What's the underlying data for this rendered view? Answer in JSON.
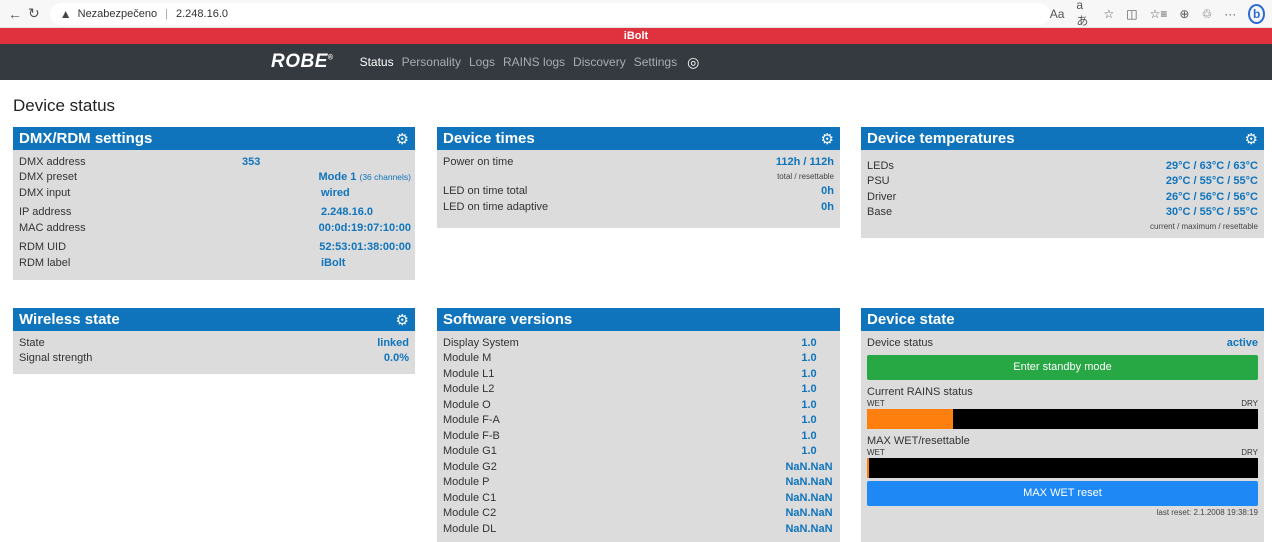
{
  "browser": {
    "back_icon": "←",
    "reload_icon": "↻",
    "security_text": "Nezabezpečeno",
    "url": "2.248.16.0",
    "icons": [
      "Aa",
      "aあ",
      "☆",
      "◫",
      "☆≡",
      "⊕",
      "♲",
      "···"
    ],
    "bing_label": "b"
  },
  "app": {
    "device_name": "iBolt",
    "logo": "ROBE",
    "nav": [
      "Status",
      "Personality",
      "Logs",
      "RAINS logs",
      "Discovery",
      "Settings"
    ],
    "active_nav": "Status"
  },
  "page_title": "Device status",
  "dmx": {
    "title": "DMX/RDM settings",
    "rows": [
      {
        "label": "DMX address",
        "value": "353"
      },
      {
        "label": "DMX preset",
        "value": "Mode 1",
        "extra": "(36 channels)"
      },
      {
        "label": "DMX input",
        "value": "wired"
      },
      {
        "label": "IP address",
        "value": "2.248.16.0"
      },
      {
        "label": "MAC address",
        "value": "00:0d:19:07:10:00"
      },
      {
        "label": "RDM UID",
        "value": "52:53:01:38:00:00"
      },
      {
        "label": "RDM label",
        "value": "iBolt"
      }
    ]
  },
  "times": {
    "title": "Device times",
    "power_on_label": "Power on time",
    "power_on_value": "112h / 112h",
    "power_on_note": "total / resettable",
    "led_total_label": "LED on time total",
    "led_total_value": "0h",
    "led_adaptive_label": "LED on time adaptive",
    "led_adaptive_value": "0h"
  },
  "temps": {
    "title": "Device temperatures",
    "rows": [
      {
        "label": "LEDs",
        "value": "29°C / 63°C / 63°C"
      },
      {
        "label": "PSU",
        "value": "29°C / 55°C / 55°C"
      },
      {
        "label": "Driver",
        "value": "26°C / 56°C / 56°C"
      },
      {
        "label": "Base",
        "value": "30°C / 55°C / 55°C"
      }
    ],
    "note": "current / maximum / resettable"
  },
  "wireless": {
    "title": "Wireless state",
    "rows": [
      {
        "label": "State",
        "value": "linked"
      },
      {
        "label": "Signal strength",
        "value": "0.0%"
      }
    ]
  },
  "software": {
    "title": "Software versions",
    "rows": [
      {
        "label": "Display System",
        "value": "1.0"
      },
      {
        "label": "Module M",
        "value": "1.0"
      },
      {
        "label": "Module L1",
        "value": "1.0"
      },
      {
        "label": "Module L2",
        "value": "1.0"
      },
      {
        "label": "Module O",
        "value": "1.0"
      },
      {
        "label": "Module F-A",
        "value": "1.0"
      },
      {
        "label": "Module F-B",
        "value": "1.0"
      },
      {
        "label": "Module G1",
        "value": "1.0"
      },
      {
        "label": "Module G2",
        "value": "NaN.NaN"
      },
      {
        "label": "Module P",
        "value": "NaN.NaN"
      },
      {
        "label": "Module C1",
        "value": "NaN.NaN"
      },
      {
        "label": "Module C2",
        "value": "NaN.NaN"
      },
      {
        "label": "Module DL",
        "value": "NaN.NaN"
      }
    ]
  },
  "state": {
    "title": "Device state",
    "status_label": "Device status",
    "status_value": "active",
    "standby_button": "Enter standby mode",
    "rains_label": "Current RAINS status",
    "wet_label": "WET",
    "dry_label": "DRY",
    "rains_level": 0.22,
    "max_wet_label": "MAX WET/resettable",
    "max_wet_level": 0.005,
    "reset_button": "MAX WET reset",
    "last_reset": "last reset: 2.1.2008 19:38:19"
  },
  "colors": {
    "accent": "#0f74bc",
    "alert_bar": "#e0313f",
    "rain_fill": "#ff7f0e"
  }
}
